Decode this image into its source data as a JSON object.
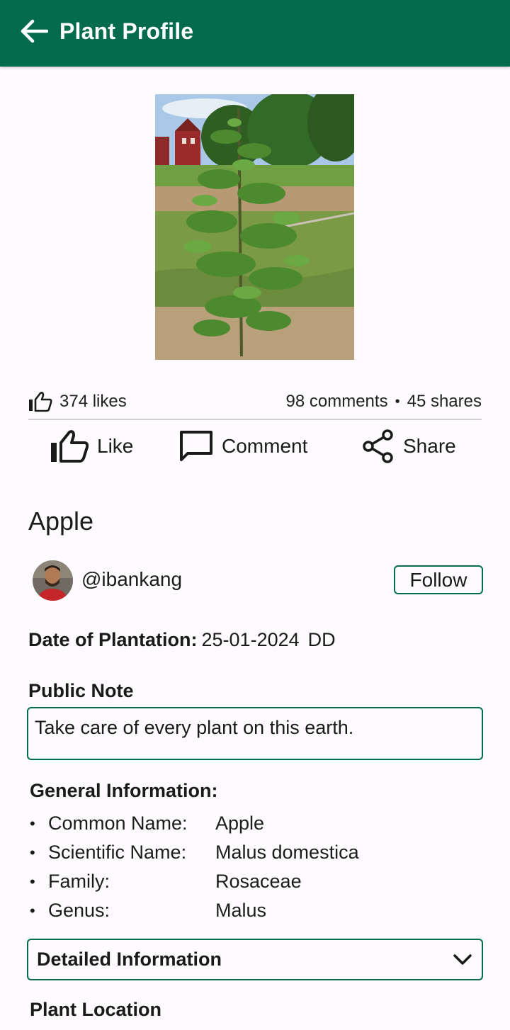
{
  "header": {
    "title": "Plant Profile",
    "color": "#046b4d"
  },
  "photo": {
    "alt": "Apple tree sapling in a field"
  },
  "stats": {
    "likes": "374 likes",
    "comments": "98 comments",
    "separator": "•",
    "shares": "45 shares"
  },
  "actions": {
    "like": "Like",
    "comment": "Comment",
    "share": "Share"
  },
  "plant": {
    "name": "Apple"
  },
  "owner": {
    "username": "@ibankang",
    "follow_label": "Follow"
  },
  "plantation": {
    "label": "Date of Plantation:",
    "value": "25-01-2024",
    "suffix": "DD"
  },
  "public_note": {
    "title": "Public Note",
    "text": "Take care of every plant on this earth."
  },
  "general_info": {
    "title": "General Information:",
    "items": [
      {
        "key": "Common Name:",
        "value": "Apple"
      },
      {
        "key": "Scientific Name:",
        "value": "Malus domestica"
      },
      {
        "key": "Family:",
        "value": "Rosaceae"
      },
      {
        "key": "Genus:",
        "value": "Malus"
      }
    ]
  },
  "detailed_info": {
    "label": "Detailed Information"
  },
  "plant_location": {
    "title": "Plant Location"
  }
}
